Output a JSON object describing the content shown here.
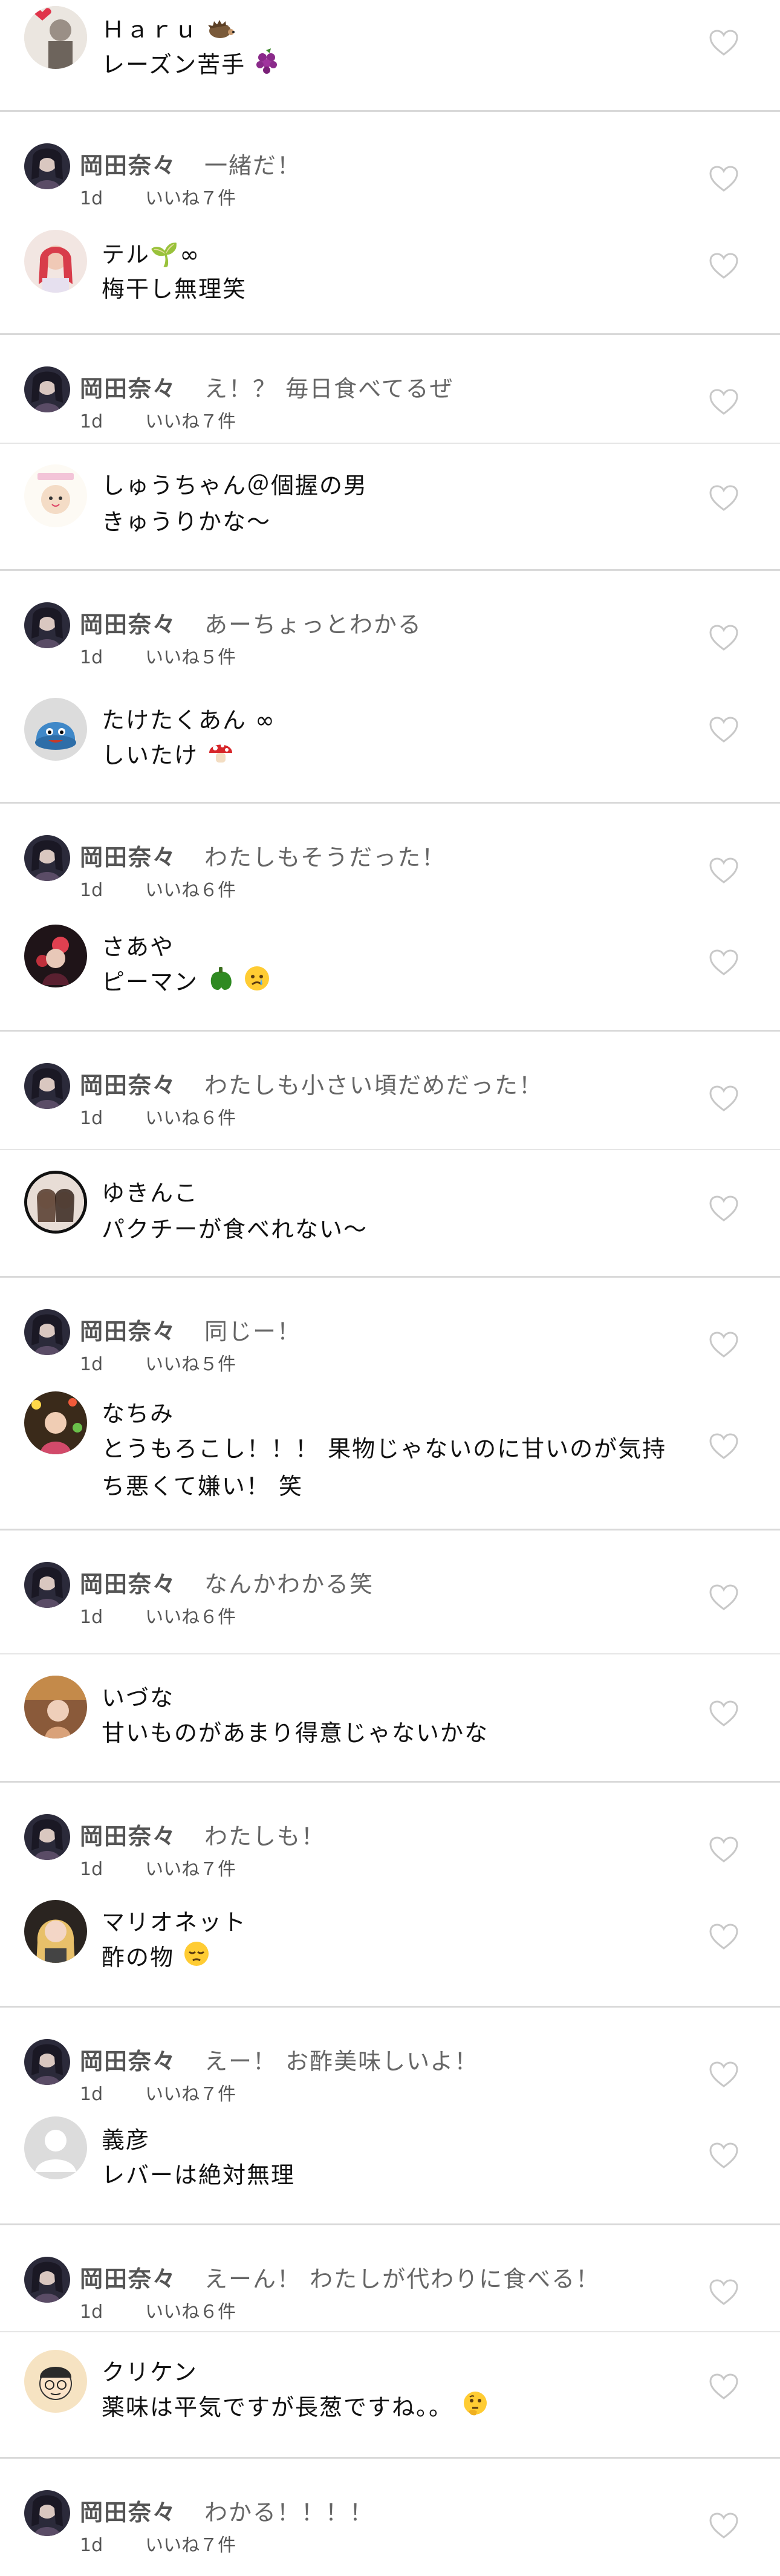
{
  "colors": {
    "separator": "#d9d9d9",
    "reply_name": "#555555",
    "reply_text": "#666666",
    "heart_outline": "#c8c8c8"
  },
  "reply_author": "岡田奈々",
  "threads": [
    {
      "comment": {
        "name": "Ｈａｒｕ",
        "name_emoji": "hedgehog",
        "text": "レーズン苦手",
        "text_emoji": "grapes"
      },
      "reply": null
    },
    {
      "reply": {
        "text": "一緒だ！",
        "time": "1d",
        "likes": "いいね７件"
      },
      "comment": {
        "name": "テル🌱∞",
        "text": "梅干し無理笑"
      }
    },
    {
      "reply": {
        "text": "え！？ 毎日食べてるぜ",
        "time": "1d",
        "likes": "いいね７件"
      },
      "comment": {
        "name": "しゅうちゃん＠個握の男",
        "text": "きゅうりかな〜"
      }
    },
    {
      "reply": {
        "text": "あーちょっとわかる",
        "time": "1d",
        "likes": "いいね５件"
      },
      "comment": {
        "name": "たけたくあん ∞",
        "text": "しいたけ",
        "text_emoji": "mushroom"
      }
    },
    {
      "reply": {
        "text": "わたしもそうだった！",
        "time": "1d",
        "likes": "いいね６件"
      },
      "comment": {
        "name": "さあや",
        "text": "ピーマン",
        "text_emoji": "pepper-sad"
      }
    },
    {
      "reply": {
        "text": "わたしも小さい頃だめだった！",
        "time": "1d",
        "likes": "いいね６件"
      },
      "comment": {
        "name": "ゆきんこ",
        "text": "パクチーが食べれない〜"
      }
    },
    {
      "reply": {
        "text": "同じー！",
        "time": "1d",
        "likes": "いいね５件"
      },
      "comment": {
        "name": "なちみ",
        "text": "とうもろこし！！！ 果物じゃないのに甘いのが気持ち悪くて嫌い！ 笑"
      }
    },
    {
      "reply": {
        "text": "なんかわかる笑",
        "time": "1d",
        "likes": "いいね６件"
      },
      "comment": {
        "name": "いづな",
        "text": "甘いものがあまり得意じゃないかな"
      }
    },
    {
      "reply": {
        "text": "わたしも！",
        "time": "1d",
        "likes": "いいね７件"
      },
      "comment": {
        "name": "マリオネット",
        "text": "酢の物",
        "text_emoji": "pensive"
      }
    },
    {
      "reply": {
        "text": "えー！ お酢美味しいよ！",
        "time": "1d",
        "likes": "いいね７件"
      },
      "comment": {
        "name": "義彦",
        "text": "レバーは絶対無理"
      }
    },
    {
      "reply": {
        "text": "えーん！ わたしが代わりに食べる！",
        "time": "1d",
        "likes": "いいね６件"
      },
      "comment": {
        "name": "クリケン",
        "text": "薬味は平気ですが長葱ですね。。",
        "text_emoji": "thinking"
      }
    },
    {
      "reply": {
        "text": "わかる！！！！",
        "time": "1d",
        "likes": "いいね７件"
      },
      "comment": null
    }
  ]
}
